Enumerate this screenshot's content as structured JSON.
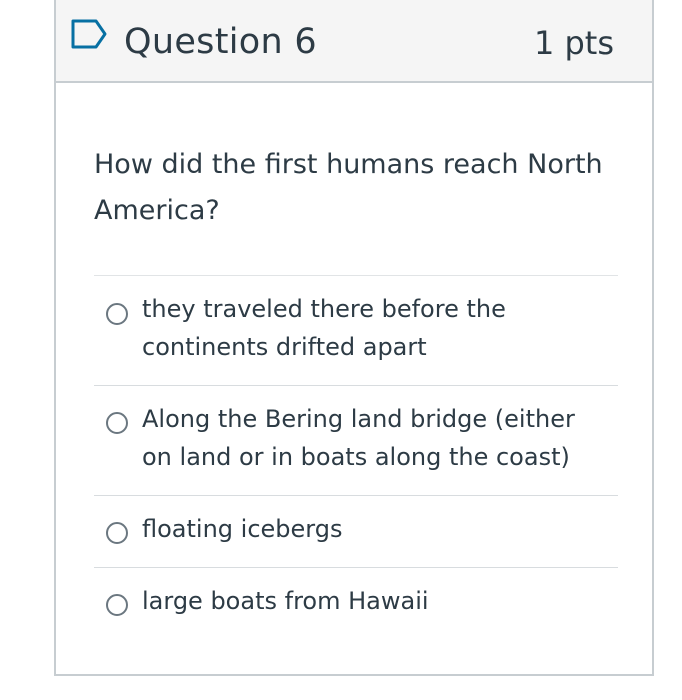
{
  "question": {
    "title": "Question 6",
    "points": "1 pts",
    "text": "How did the first humans reach North America?",
    "flag_icon": "flag-outline-icon"
  },
  "answers": [
    {
      "label": "they traveled there before the continents drifted apart",
      "selected": false
    },
    {
      "label": "Along the Bering land bridge (either on land or in boats along the coast)",
      "selected": false
    },
    {
      "label": "floating icebergs",
      "selected": false
    },
    {
      "label": "large boats from Hawaii",
      "selected": false
    }
  ],
  "colors": {
    "accent": "#0770a3",
    "text": "#2d3b45",
    "border": "#c7cdd1",
    "header_bg": "#f5f5f5"
  }
}
